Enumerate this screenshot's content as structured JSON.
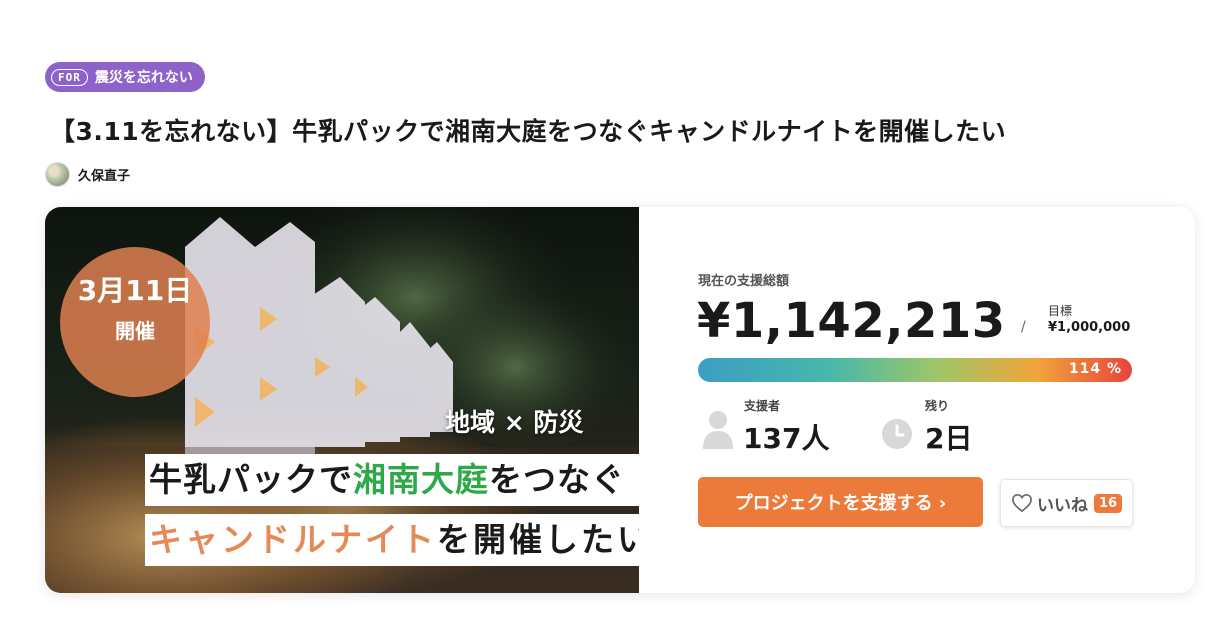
{
  "tag": {
    "prefix": "FOR",
    "label": "震災を忘れない"
  },
  "project": {
    "title": "【3.11を忘れない】牛乳パックで湘南大庭をつなぐキャンドルナイトを開催したい",
    "owner": "久保直子"
  },
  "hero": {
    "badge_date": "3月11日",
    "badge_sub": "開催",
    "tagline": "地域 × 防災",
    "line1_a": "牛乳パックで",
    "line1_b": "湘南大庭",
    "line1_c": "をつなぐ",
    "line2_a": "キャンドルナイト",
    "line2_b": "を開催したい"
  },
  "funding": {
    "raised_label": "現在の支援総額",
    "raised": "¥1,142,213",
    "slash": "/",
    "goal_label": "目標",
    "goal": "¥1,000,000",
    "percent_text": "114 %",
    "progress_percent": 114
  },
  "stats": {
    "supporters_label": "支援者",
    "supporters": "137人",
    "remaining_label": "残り",
    "remaining": "2日"
  },
  "actions": {
    "support_label": "プロジェクトを支援する ›",
    "like_label": "いいね",
    "like_count": "16"
  },
  "colors": {
    "tag": "#8e63c9",
    "accent": "#ec7a3b",
    "green_text": "#2fa84a",
    "orange_text": "#e58a56"
  },
  "icons": [
    "person-icon",
    "clock-icon",
    "heart-icon"
  ]
}
